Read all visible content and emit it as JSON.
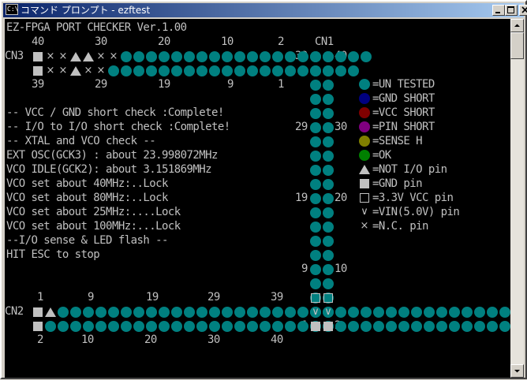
{
  "window": {
    "title": "コマンド プロンプト - ezftest",
    "icon_label": "C:\\"
  },
  "colors": {
    "untested": "#008080",
    "gnd_short": "#000080",
    "vcc_short": "#800000",
    "pin_short": "#800080",
    "sense_h": "#808000",
    "ok": "#008000",
    "text": "#c0c0c0"
  },
  "console": {
    "header": "EZ-FPGA PORT CHECKER Ver.1.00",
    "cn1_label": "CN1",
    "cn3": {
      "label": "CN3",
      "top_numbers": [
        "40",
        "30",
        "20",
        "10",
        "2"
      ],
      "bottom_numbers": [
        "39",
        "29",
        "19",
        "9",
        "1"
      ],
      "row_top": "SXXTTXXOOOOOOOOOOOOOOOOOOOO",
      "row_bottom": "SXXTXXOOOOOOOOOOOOOOOOOOOO"
    },
    "cn2": {
      "label": "CN2",
      "top_numbers": [
        "1",
        "9",
        "19",
        "29",
        "39"
      ],
      "bottom_numbers": [
        "2",
        "10",
        "20",
        "30",
        "40"
      ],
      "row_top": "STOOOOOOOOOOOOOOOOOOOOOOOOOOOOOOOOOOOOOOOOOOOO",
      "row_bottom": "SOOOOOOOOOOOOOOOOOOOOOOOOOOOOOOOOOOOOOOOOOOOOO"
    },
    "cn1": {
      "numbers_left": [
        "39",
        "29",
        "19",
        "9",
        "1"
      ],
      "numbers_right": [
        "40",
        "30",
        "20",
        "10",
        "2"
      ]
    },
    "messages": [
      "-- VCC / GND short check :Complete!",
      "-- I/O to I/O short check :Complete!",
      "-- XTAL and VCO check --",
      "EXT OSC(GCK3) : about 23.998072MHz",
      "VCO IDLE(GCK2): about 3.151869MHz",
      "VCO set about 40MHz:..Lock",
      "VCO set about 80MHz:..Lock",
      "VCO set about 25MHz:....Lock",
      "VCO set about 100MHz:...Lock",
      "--I/O sense & LED flash --",
      "HIT ESC to stop"
    ],
    "legend": [
      {
        "icon": "dot",
        "color": "#008080",
        "label": "=UN TESTED"
      },
      {
        "icon": "dot",
        "color": "#000080",
        "label": "=GND SHORT"
      },
      {
        "icon": "dot",
        "color": "#800000",
        "label": "=VCC SHORT"
      },
      {
        "icon": "dot",
        "color": "#800080",
        "label": "=PIN SHORT"
      },
      {
        "icon": "dot",
        "color": "#808000",
        "label": "=SENSE H"
      },
      {
        "icon": "dot",
        "color": "#008000",
        "label": "=OK"
      },
      {
        "icon": "triangle",
        "color": "#c0c0c0",
        "label": "=NOT I/O pin"
      },
      {
        "icon": "filled-square",
        "color": "#c0c0c0",
        "label": "=GND pin"
      },
      {
        "icon": "outline-square",
        "color": "#c0c0c0",
        "label": "=3.3V VCC pin"
      },
      {
        "icon": "v-mark",
        "color": "#c0c0c0",
        "label": "=VIN(5.0V) pin"
      },
      {
        "icon": "x-mark",
        "color": "#c0c0c0",
        "label": "=N.C. pin"
      }
    ]
  }
}
